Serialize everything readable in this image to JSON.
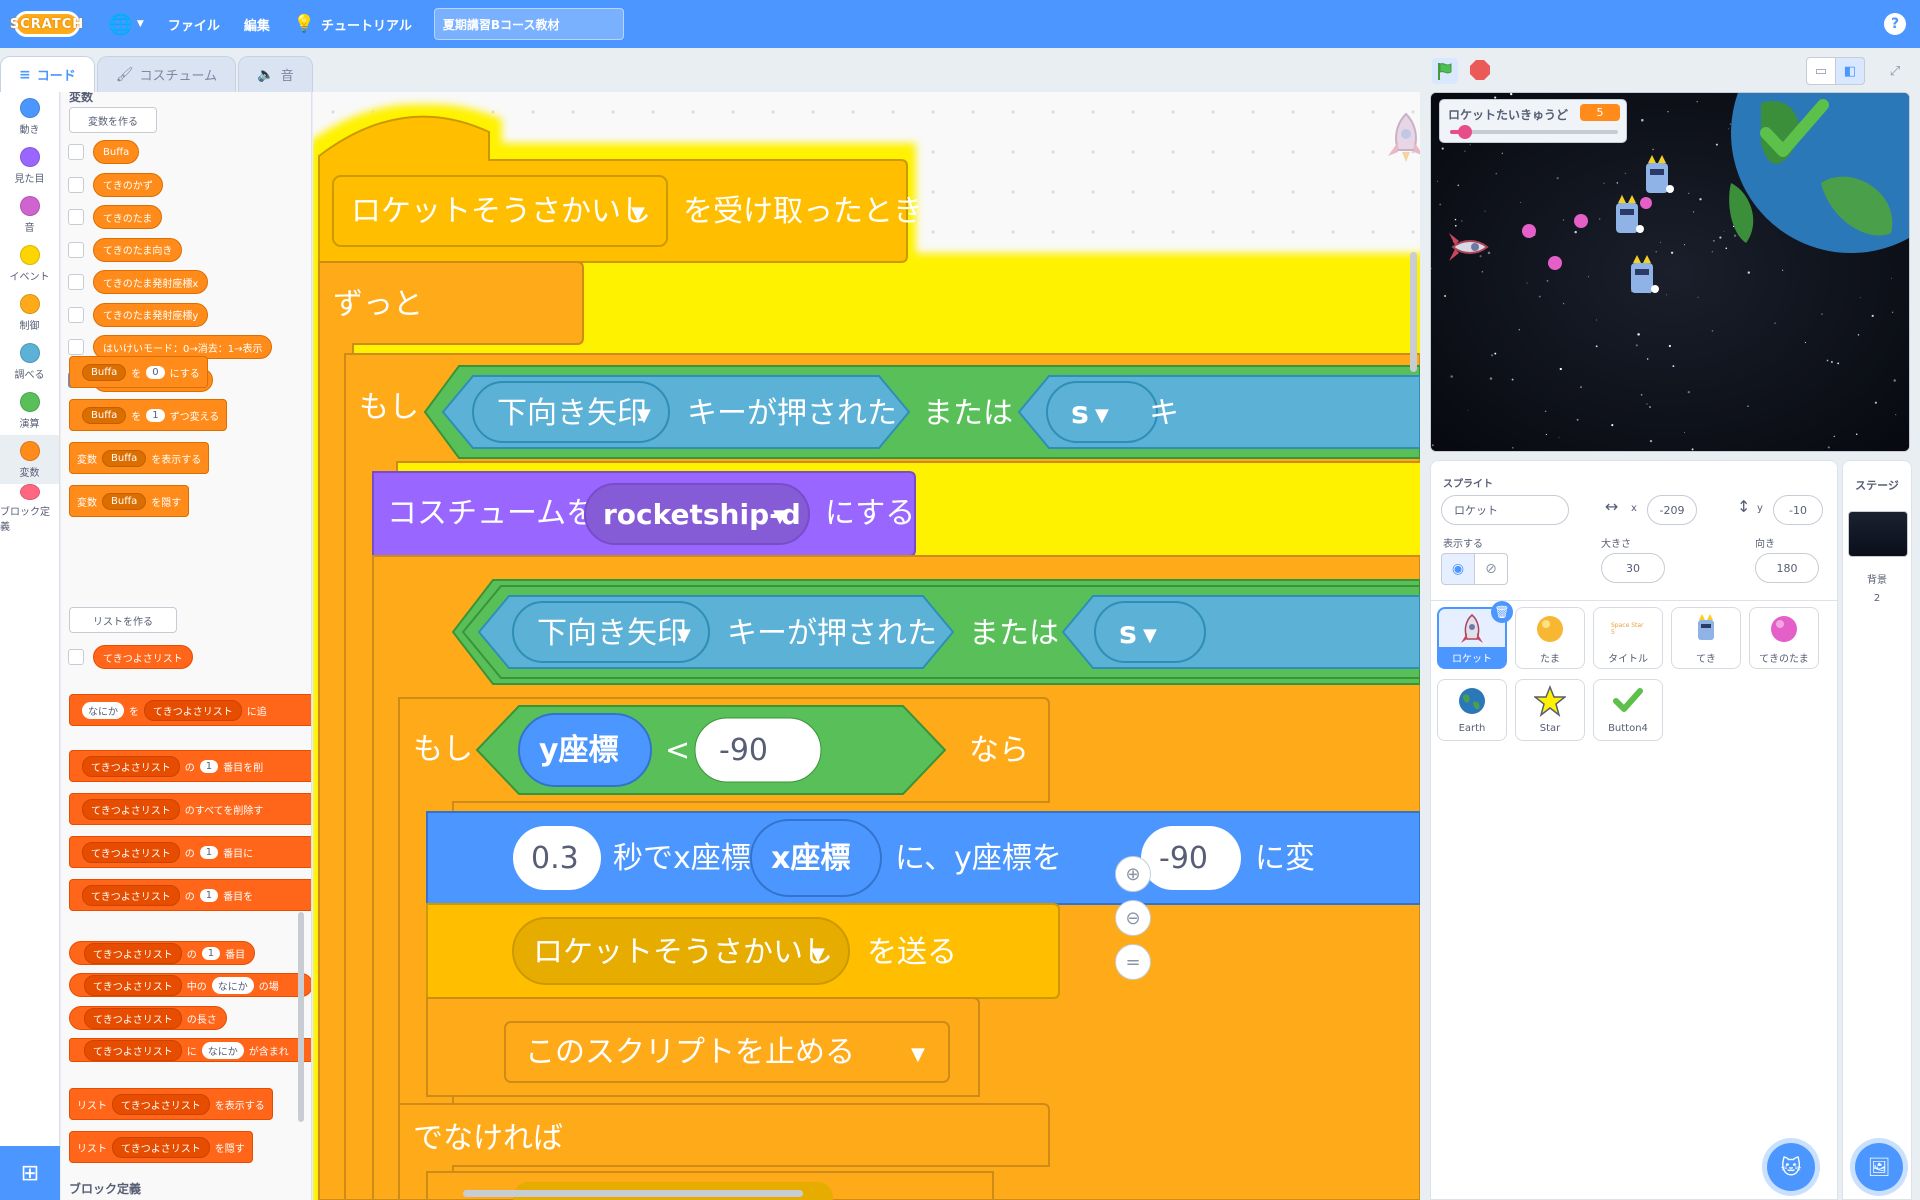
{
  "menubar": {
    "logo": "SCRATCH",
    "file": "ファイル",
    "edit": "編集",
    "tutorials": "チュートリアル",
    "project_title": "夏期講習Bコース教材",
    "help": "?"
  },
  "tabs": {
    "code": "コード",
    "costumes": "コスチューム",
    "sounds": "音"
  },
  "categories": [
    {
      "label": "動き",
      "color": "#4c97ff"
    },
    {
      "label": "見た目",
      "color": "#9966ff"
    },
    {
      "label": "音",
      "color": "#cf63cf"
    },
    {
      "label": "イベント",
      "color": "#ffd500"
    },
    {
      "label": "制御",
      "color": "#ffab19"
    },
    {
      "label": "調べる",
      "color": "#5cb1d6"
    },
    {
      "label": "演算",
      "color": "#59c059"
    },
    {
      "label": "変数",
      "color": "#ff8c1a"
    },
    {
      "label": "ブロック定義",
      "color": "#ff6680"
    }
  ],
  "palette": {
    "heading": "変数",
    "make_variable": "変数を作る",
    "variables": [
      "Buffa",
      "てきのかず",
      "てきのたま",
      "てきのたま向き",
      "てきのたま発射座標x",
      "てきのたま発射座標y",
      "はいけいモード：0→消去：1→表示",
      "ロケットたいきゅうど"
    ],
    "checked_variable": "ロケットたいきゅうど",
    "blocks": {
      "set_var": "Buffa",
      "set_to": "を",
      "set_value": "0",
      "set_suffix": "にする",
      "change_var": "Buffa",
      "change_by": "を",
      "change_value": "1",
      "change_suffix": "ずつ変える",
      "show_prefix": "変数",
      "show_var": "Buffa",
      "show_suffix": "を表示する",
      "hide_prefix": "変数",
      "hide_var": "Buffa",
      "hide_suffix": "を隠す"
    },
    "make_list": "リストを作る",
    "list_name": "てきつよさリスト",
    "list_blocks": {
      "add_item": "なにか",
      "add_to": "を",
      "add_suffix": "に追",
      "delete_of": "の",
      "delete_index": "1",
      "delete_suffix": "番目を削",
      "delete_all": "のすべてを削除す",
      "insert_of": "の",
      "insert_index": "1",
      "insert_suffix": "番目に",
      "replace_of": "の",
      "replace_index": "1",
      "replace_suffix": "番目を",
      "item_of": "の",
      "item_index": "1",
      "item_suffix": "番目",
      "item_num_in": "中の",
      "item_num_item": "なにか",
      "item_num_suffix": "の場",
      "length_suffix": "の長さ",
      "contains_in": "に",
      "contains_item": "なにか",
      "contains_suffix": "が含まれ",
      "show_prefix": "リスト",
      "show_suffix": "を表示する",
      "hide_prefix": "リスト",
      "hide_suffix": "を隠す"
    },
    "my_blocks_heading": "ブロック定義"
  },
  "script": {
    "hat_message": "ロケットそうさかいし",
    "hat_suffix": "を受け取ったとき",
    "forever": "ずっと",
    "if": "もし",
    "key_down": "下向き矢印",
    "key_pressed": "キーが押された",
    "or": "または",
    "key_s": "s",
    "key_pressed_cut": "キ",
    "costume_prefix": "コスチュームを",
    "costume_value": "rocketship-d",
    "costume_suffix": "にする",
    "if2": "もし",
    "y_reporter": "y座標",
    "lt": "<",
    "compare_value": "-90",
    "then": "なら",
    "glide_secs": "0.3",
    "glide_mid": "秒でx座標を",
    "glide_x": "x座標",
    "glide_mid2": "に、y座標を",
    "glide_y": "-90",
    "glide_suffix": "に変",
    "broadcast_message": "ロケットそうさかいし",
    "broadcast_suffix": "を送る",
    "stop_option": "このスクリプトを止める",
    "else": "でなければ"
  },
  "stage": {
    "monitor_label": "ロケットたいきゅうど",
    "monitor_value": "5",
    "monitor_fraction": 0.05
  },
  "sprite_info": {
    "sprite_label": "スプライト",
    "sprite_name": "ロケット",
    "x_label": "x",
    "x_value": "-209",
    "y_label": "y",
    "y_value": "-10",
    "show_label": "表示する",
    "size_label": "大きさ",
    "size_value": "30",
    "direction_label": "向き",
    "direction_value": "180"
  },
  "sprites": [
    {
      "name": "ロケット",
      "selected": true
    },
    {
      "name": "たま"
    },
    {
      "name": "タイトル",
      "thumb_text": "Space Star 5"
    },
    {
      "name": "てき"
    },
    {
      "name": "てきのたま"
    },
    {
      "name": "Earth"
    },
    {
      "name": "Star"
    },
    {
      "name": "Button4"
    }
  ],
  "stage_pane": {
    "title": "ステージ",
    "backdrops_label": "背景",
    "backdrops_count": "2"
  },
  "colors": {
    "menu_blue": "#4c97ff",
    "variables": "#ff8c1a",
    "lists": "#ff661a",
    "control": "#ffab19",
    "operators": "#59c059",
    "sensing": "#5cb1d6",
    "looks": "#9966ff",
    "motion": "#4c97ff",
    "glow": "#fff200"
  }
}
